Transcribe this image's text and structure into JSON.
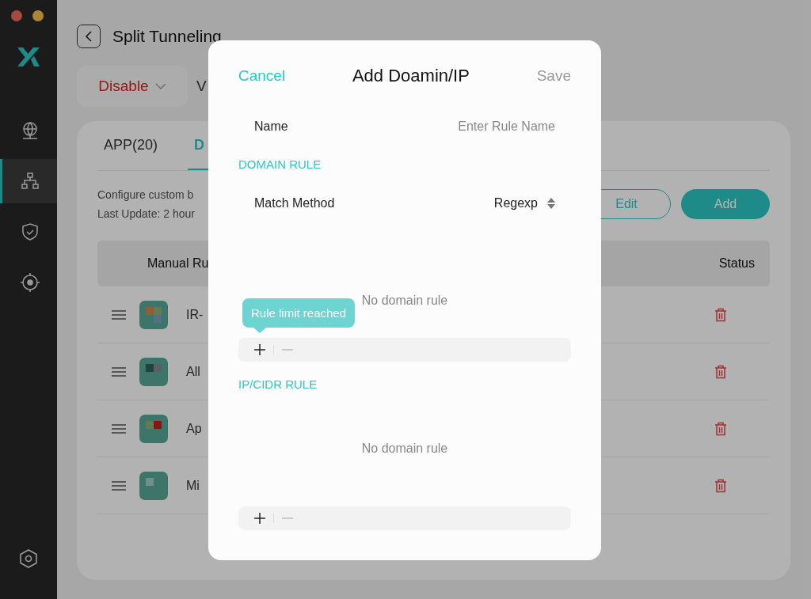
{
  "sidebar": {
    "items": [
      {
        "selected": false
      },
      {
        "selected": true
      },
      {
        "selected": false
      },
      {
        "selected": false
      }
    ]
  },
  "header": {
    "title": "Split Tunneling",
    "mode": "Disable",
    "mode_2": "V"
  },
  "tabs": [
    {
      "label": "APP(20)",
      "selected": false
    },
    {
      "label": "D",
      "selected": true
    }
  ],
  "description": [
    "Configure custom b",
    "Last Update: 2 hour"
  ],
  "actions": [
    {
      "label": "Edit",
      "kind": "outline"
    },
    {
      "label": "Add",
      "kind": "filled"
    }
  ],
  "table": {
    "columns": [
      "Manual Ru",
      "Status"
    ],
    "rows": [
      {
        "name": "IR-"
      },
      {
        "name": "All"
      },
      {
        "name": "Ap"
      },
      {
        "name": "Mi"
      }
    ]
  },
  "dialog": {
    "cancel": "Cancel",
    "title": "Add Doamin/IP",
    "save": {
      "label": "Save",
      "disabled": true
    },
    "name_label": "Name",
    "name_placeholder": "Enter Rule Name",
    "sections": [
      {
        "title": "DOMAIN RULE",
        "match_label": "Match Method",
        "match_value": "Regexp",
        "empty": "No domain rule",
        "tooltip": "Rule limit reached",
        "remove_disabled": true
      },
      {
        "title": "IP/CIDR RULE",
        "empty": "No domain rule",
        "remove_disabled": true
      }
    ]
  }
}
